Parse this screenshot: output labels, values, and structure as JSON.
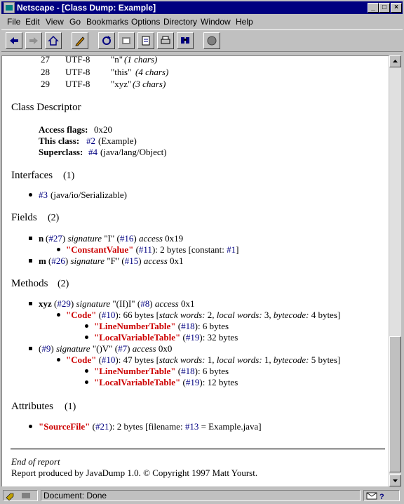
{
  "window": {
    "title": "Netscape - [Class Dump: Example]"
  },
  "menu": [
    "File",
    "Edit",
    "View",
    "Go",
    "Bookmarks",
    "Options",
    "Directory",
    "Window",
    "Help"
  ],
  "toolbar": [
    "back-icon",
    "forward-icon",
    "home-icon",
    "edit-icon",
    "reload-icon",
    "images-icon",
    "open-icon",
    "print-icon",
    "find-icon",
    "stop-icon"
  ],
  "constants": [
    {
      "num": "27",
      "type": "UTF-8",
      "value": "\"n\"",
      "chars": "(1 chars)"
    },
    {
      "num": "28",
      "type": "UTF-8",
      "value": "\"this\"",
      "chars": "(4 chars)"
    },
    {
      "num": "29",
      "type": "UTF-8",
      "value": "\"xyz\"",
      "chars": "(3 chars)"
    }
  ],
  "class_descriptor": {
    "heading": "Class Descriptor",
    "access_label": "Access flags:",
    "access_value": "0x20",
    "this_label": "This class:",
    "this_ref": "#2",
    "this_name": "(Example)",
    "super_label": "Superclass:",
    "super_ref": "#4",
    "super_name": "(java/lang/Object)"
  },
  "interfaces": {
    "heading": "Interfaces",
    "count": "(1)",
    "items": [
      {
        "ref": "#3",
        "name": "(java/io/Serializable)"
      }
    ]
  },
  "fields": {
    "heading": "Fields",
    "count": "(2)",
    "f1": {
      "name": "n",
      "ref": "#27",
      "sig_label": "signature",
      "sig": "\"I\"",
      "sig_ref": "#16",
      "acc_label": "access",
      "acc": "0x19",
      "attr": {
        "name": "\"ConstantValue\"",
        "ref": "#11",
        "tail": ": 2 bytes [constant: ",
        "const_ref": "#1",
        "end": "]"
      }
    },
    "f2": {
      "name": "m",
      "ref": "#26",
      "sig_label": "signature",
      "sig": "\"F\"",
      "sig_ref": "#15",
      "acc_label": "access",
      "acc": "0x1"
    }
  },
  "methods": {
    "heading": "Methods",
    "count": "(2)",
    "m1": {
      "name": "xyz",
      "ref": "#29",
      "sig": "\"(II)I\"",
      "sig_ref": "#8",
      "acc": "0x1",
      "code": {
        "name": "\"Code\"",
        "ref": "#10",
        "bytes": ": 66 bytes [",
        "stack_label": "stack words:",
        "stack": "2,",
        "local_label": "local words:",
        "local": "3,",
        "bc_label": "bytecode:",
        "bc": "4 bytes]"
      },
      "lnt": {
        "name": "\"LineNumberTable\"",
        "ref": "#18",
        "tail": ": 6 bytes"
      },
      "lvt": {
        "name": "\"LocalVariableTable\"",
        "ref": "#19",
        "tail": ": 32 bytes"
      }
    },
    "m2": {
      "ref": "#9",
      "sig": "\"()V\"",
      "sig_ref": "#7",
      "acc": "0x0",
      "code": {
        "name": "\"Code\"",
        "ref": "#10",
        "bytes": ": 47 bytes [",
        "stack_label": "stack words:",
        "stack": "1,",
        "local_label": "local words:",
        "local": "1,",
        "bc_label": "bytecode:",
        "bc": "5 bytes]"
      },
      "lnt": {
        "name": "\"LineNumberTable\"",
        "ref": "#18",
        "tail": ": 6 bytes"
      },
      "lvt": {
        "name": "\"LocalVariableTable\"",
        "ref": "#19",
        "tail": ": 12 bytes"
      }
    }
  },
  "attributes": {
    "heading": "Attributes",
    "count": "(1)",
    "a1": {
      "name": "\"SourceFile\"",
      "ref": "#21",
      "tail": ": 2 bytes [filename: ",
      "fref": "#13",
      "end": "= Example.java]"
    }
  },
  "footer": {
    "end": "End of report",
    "produced": "Report produced by JavaDump 1.0. © Copyright 1997 Matt Yourst."
  },
  "status": {
    "text": "Document: Done"
  }
}
